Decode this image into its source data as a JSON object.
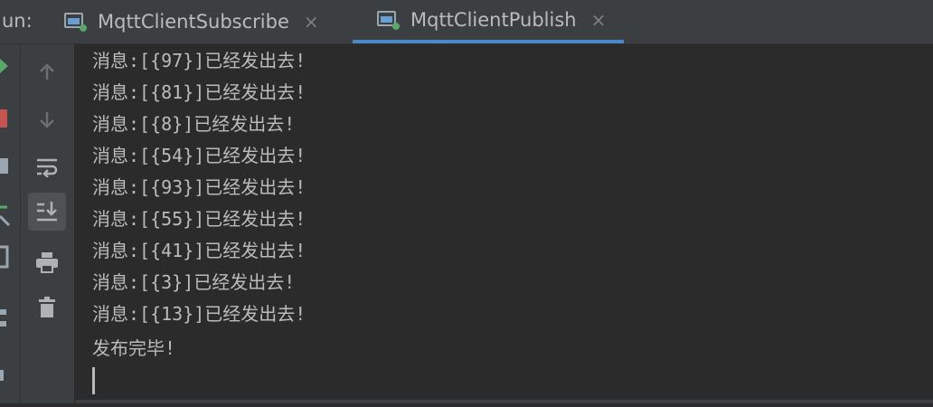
{
  "run_label": "un:",
  "tabs": [
    {
      "label": "MqttClientSubscribe",
      "active": false
    },
    {
      "label": "MqttClientPublish",
      "active": true
    }
  ],
  "tab_close_glyph": "×",
  "toolbar": {
    "items": [
      {
        "icon": "arrow-up-icon"
      },
      {
        "icon": "arrow-down-icon"
      },
      {
        "icon": "soft-wrap-icon"
      },
      {
        "icon": "scroll-to-end-icon",
        "active": true
      },
      {
        "icon": "print-icon"
      },
      {
        "icon": "trash-icon"
      }
    ]
  },
  "console": {
    "lines": [
      "消息:[{97}]已经发出去!",
      "消息:[{81}]已经发出去!",
      "消息:[{8}]已经发出去!",
      "消息:[{54}]已经发出去!",
      "消息:[{93}]已经发出去!",
      "消息:[{55}]已经发出去!",
      "消息:[{41}]已经发出去!",
      "消息:[{3}]已经发出去!",
      "消息:[{13}]已经发出去!",
      "发布完毕!"
    ]
  },
  "colors": {
    "accent": "#4a88c7",
    "run_green": "#59a869",
    "stop_red": "#c75450",
    "text": "#bbbbbb"
  }
}
